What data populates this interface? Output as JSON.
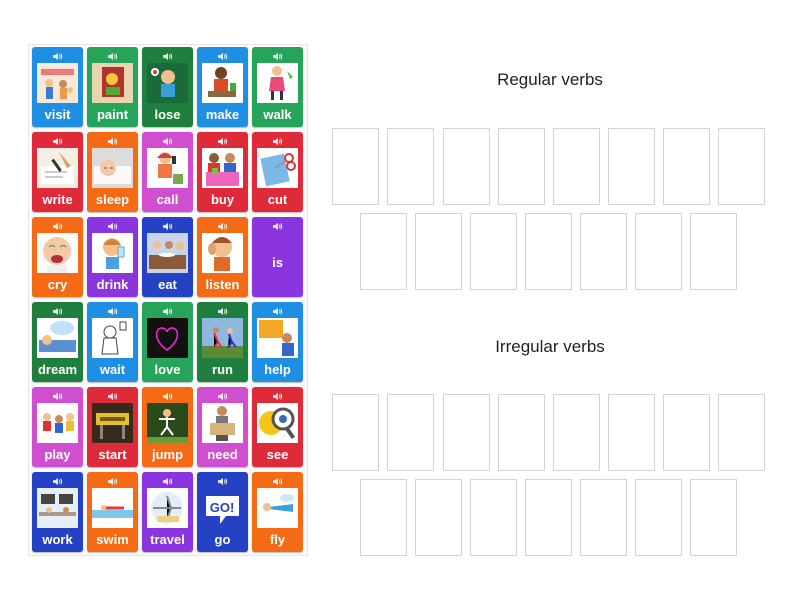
{
  "colors": {
    "green": "#26a55a",
    "darkgreen": "#1f7f3f",
    "blue": "#1e8fe2",
    "red": "#df2a3a",
    "orange": "#f56a14",
    "pink": "#d04fd0",
    "purple": "#8b35e0",
    "navy": "#2541c4"
  },
  "tiles": [
    {
      "word": "visit",
      "color": "blue",
      "icon": "family-visit-picture"
    },
    {
      "word": "paint",
      "color": "green",
      "icon": "painting-picture"
    },
    {
      "word": "lose",
      "color": "darkgreen",
      "icon": "sad-boy-picture"
    },
    {
      "word": "make",
      "color": "blue",
      "icon": "boy-making-picture"
    },
    {
      "word": "walk",
      "color": "green",
      "icon": "girl-walking-picture"
    },
    {
      "word": "write",
      "color": "red",
      "icon": "hand-writing-picture"
    },
    {
      "word": "sleep",
      "color": "orange",
      "icon": "baby-sleeping-picture"
    },
    {
      "word": "call",
      "color": "pink",
      "icon": "girl-calling-picture"
    },
    {
      "word": "buy",
      "color": "red",
      "icon": "shopping-picture"
    },
    {
      "word": "cut",
      "color": "red",
      "icon": "scissors-cutting-picture"
    },
    {
      "word": "cry",
      "color": "orange",
      "icon": "baby-crying-picture"
    },
    {
      "word": "drink",
      "color": "purple",
      "icon": "boy-drinking-picture"
    },
    {
      "word": "eat",
      "color": "navy",
      "icon": "family-eating-picture"
    },
    {
      "word": "listen",
      "color": "orange",
      "icon": "boy-listening-picture"
    },
    {
      "word": "is",
      "color": "purple",
      "icon": ""
    },
    {
      "word": "dream",
      "color": "darkgreen",
      "icon": "boy-dreaming-picture"
    },
    {
      "word": "wait",
      "color": "blue",
      "icon": "person-waiting-picture"
    },
    {
      "word": "love",
      "color": "green",
      "icon": "heart-dark-picture"
    },
    {
      "word": "run",
      "color": "darkgreen",
      "icon": "runners-picture"
    },
    {
      "word": "help",
      "color": "blue",
      "icon": "help-sign-picture"
    },
    {
      "word": "play",
      "color": "pink",
      "icon": "kids-playing-picture"
    },
    {
      "word": "start",
      "color": "red",
      "icon": "start-sign-picture"
    },
    {
      "word": "jump",
      "color": "orange",
      "icon": "jumping-picture"
    },
    {
      "word": "need",
      "color": "pink",
      "icon": "man-with-sign-picture"
    },
    {
      "word": "see",
      "color": "red",
      "icon": "magnifier-eye-picture"
    },
    {
      "word": "work",
      "color": "navy",
      "icon": "office-workers-picture"
    },
    {
      "word": "swim",
      "color": "orange",
      "icon": "swimmer-picture"
    },
    {
      "word": "travel",
      "color": "purple",
      "icon": "airplane-travel-picture"
    },
    {
      "word": "go",
      "color": "navy",
      "icon": "go-sign-picture"
    },
    {
      "word": "fly",
      "color": "orange",
      "icon": "boy-flying-picture"
    }
  ],
  "groups": [
    {
      "title": "Regular verbs"
    },
    {
      "title": "Irregular verbs"
    }
  ]
}
